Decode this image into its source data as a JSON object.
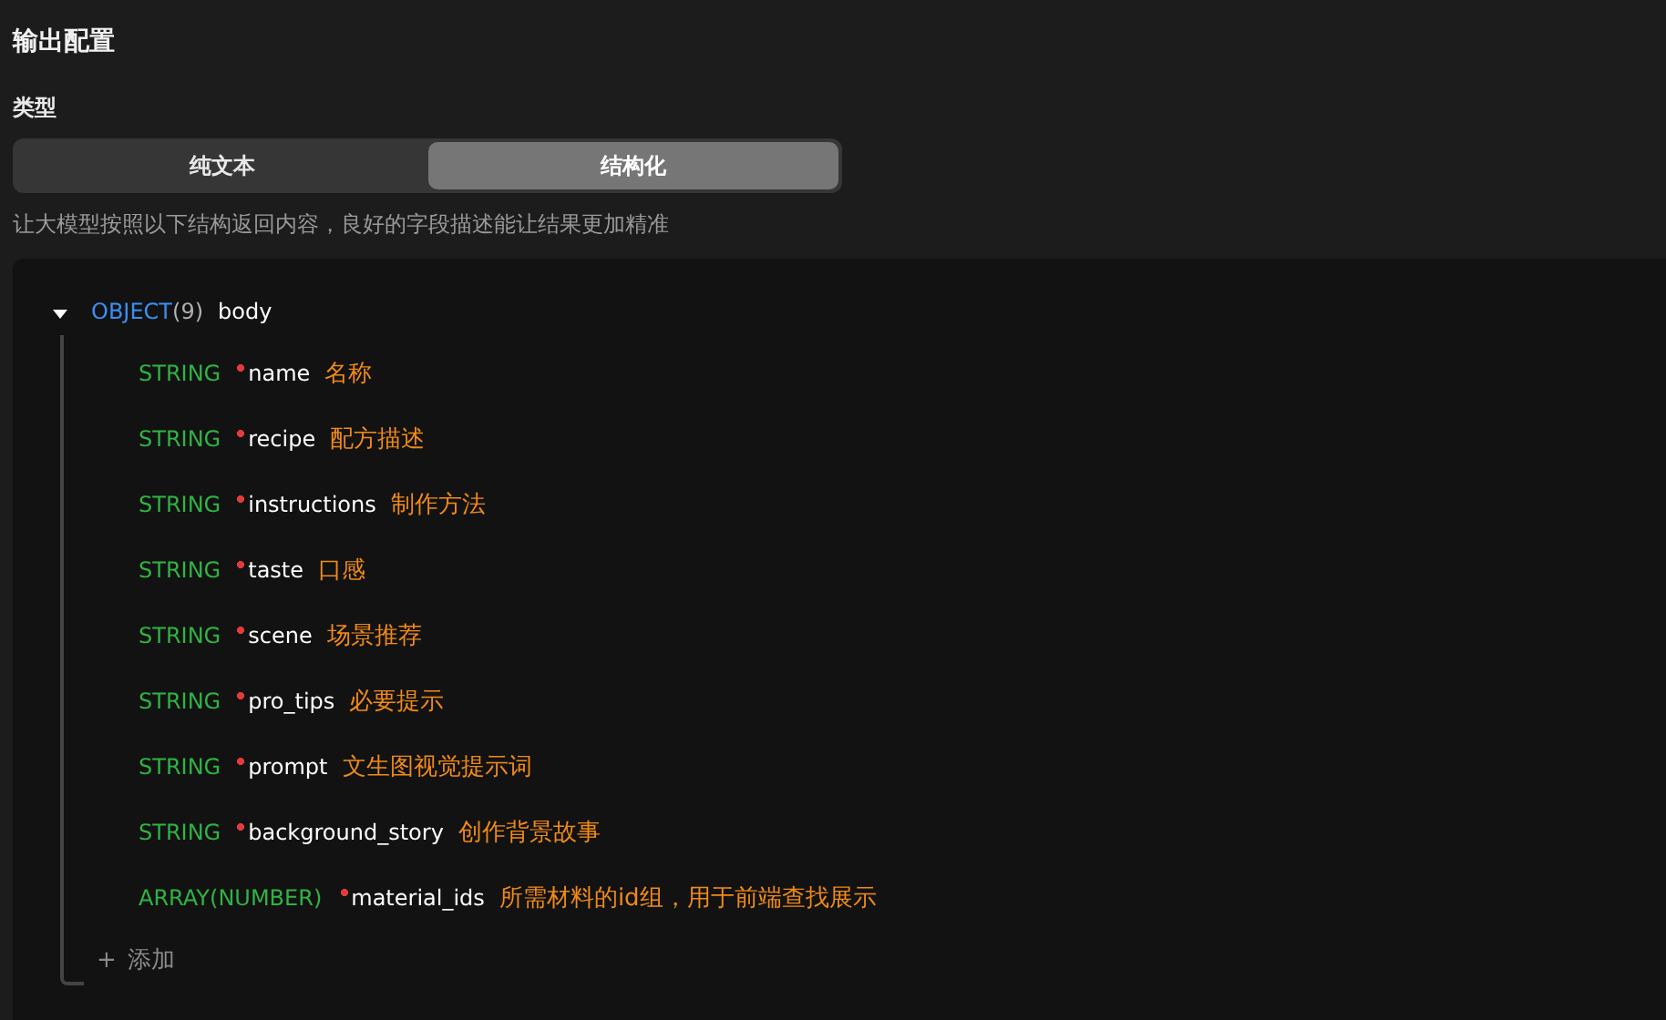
{
  "section_title": "输出配置",
  "type_label": "类型",
  "type_options": [
    {
      "label": "纯文本",
      "selected": false
    },
    {
      "label": "结构化",
      "selected": true
    }
  ],
  "hint": "让大模型按照以下结构返回内容，良好的字段描述能让结果更加精准",
  "schema": {
    "type": "OBJECT",
    "count": "(9)",
    "name": "body",
    "expanded": true,
    "children": [
      {
        "type": "STRING",
        "required": true,
        "name": "name",
        "description": "名称"
      },
      {
        "type": "STRING",
        "required": true,
        "name": "recipe",
        "description": "配方描述"
      },
      {
        "type": "STRING",
        "required": true,
        "name": "instructions",
        "description": "制作方法"
      },
      {
        "type": "STRING",
        "required": true,
        "name": "taste",
        "description": "口感"
      },
      {
        "type": "STRING",
        "required": true,
        "name": "scene",
        "description": "场景推荐"
      },
      {
        "type": "STRING",
        "required": true,
        "name": "pro_tips",
        "description": "必要提示"
      },
      {
        "type": "STRING",
        "required": true,
        "name": "prompt",
        "description": "文生图视觉提示词"
      },
      {
        "type": "STRING",
        "required": true,
        "name": "background_story",
        "description": "创作背景故事"
      },
      {
        "type": "ARRAY(NUMBER)",
        "required": true,
        "name": "material_ids",
        "description": "所需材料的id组，用于前端查找展示"
      }
    ],
    "add": {
      "icon": "+",
      "label": "添加"
    }
  }
}
